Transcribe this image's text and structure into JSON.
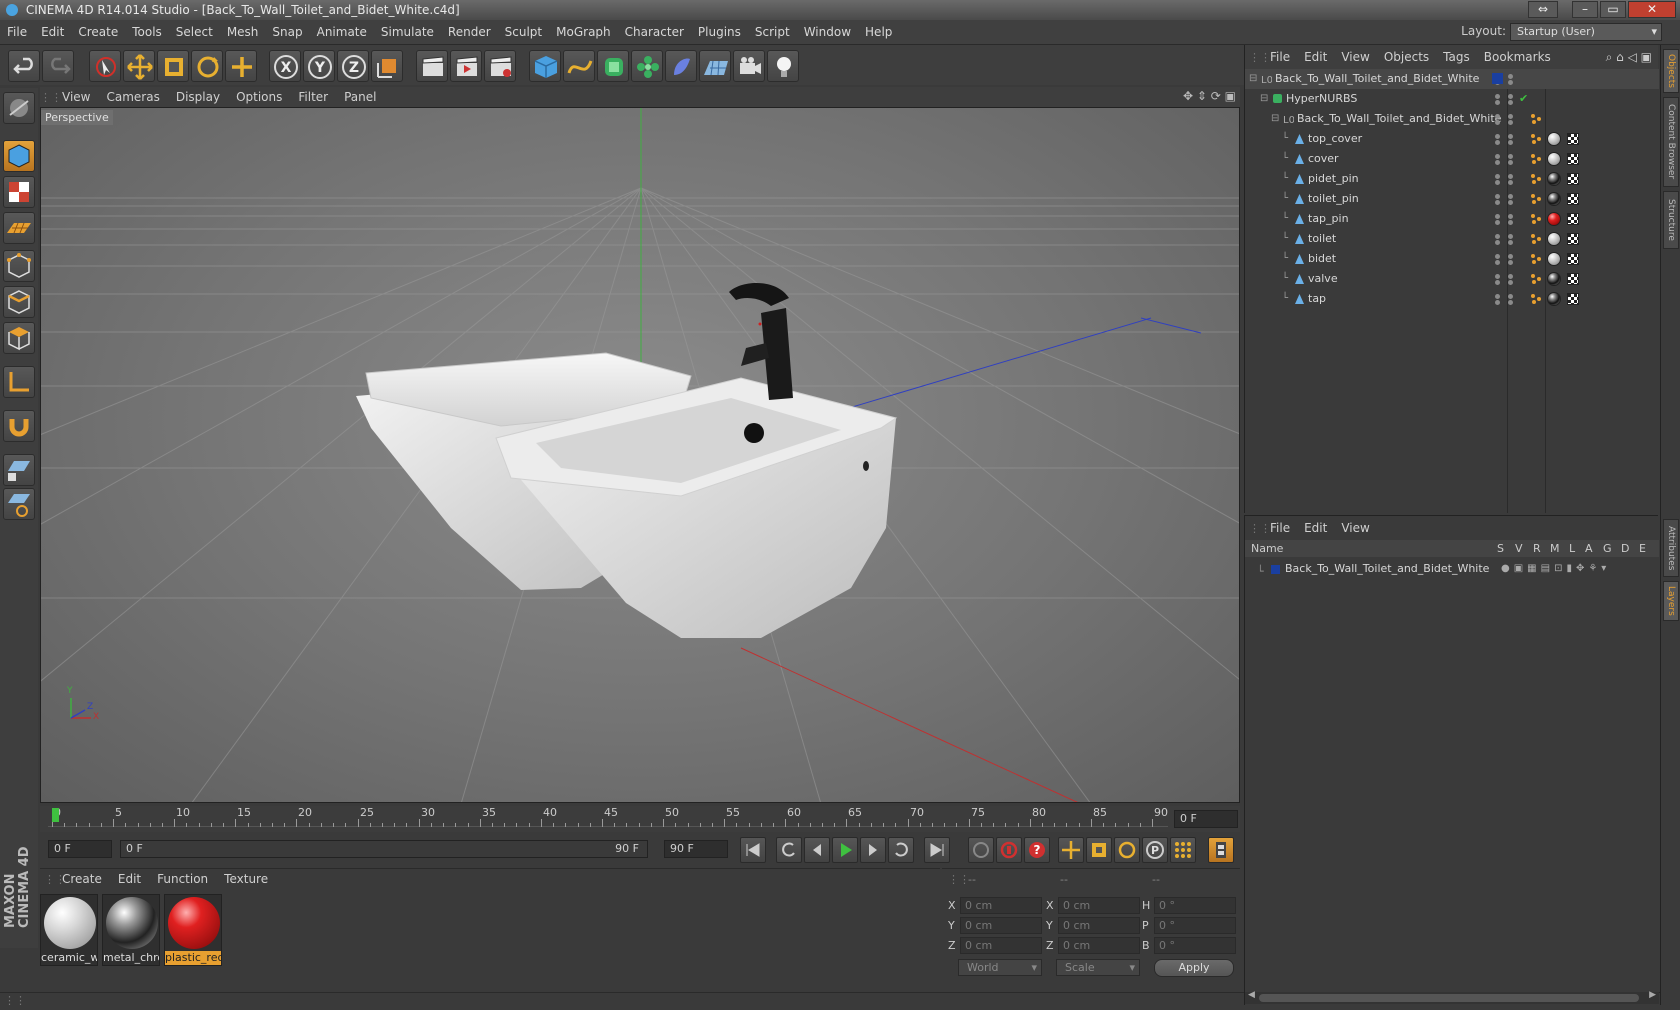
{
  "window": {
    "title": "CINEMA 4D R14.014 Studio - [Back_To_Wall_Toilet_and_Bidet_White.c4d]"
  },
  "menubar": [
    "File",
    "Edit",
    "Create",
    "Tools",
    "Select",
    "Mesh",
    "Snap",
    "Animate",
    "Simulate",
    "Render",
    "Sculpt",
    "MoGraph",
    "Character",
    "Plugins",
    "Script",
    "Window",
    "Help"
  ],
  "layout": {
    "label": "Layout:",
    "value": "Startup (User)"
  },
  "viewport": {
    "menu": [
      "View",
      "Cameras",
      "Display",
      "Options",
      "Filter",
      "Panel"
    ],
    "label": "Perspective",
    "axis": {
      "x": "X",
      "y": "Y",
      "z": "Z"
    }
  },
  "timeline": {
    "ticks": [
      "0",
      "5",
      "10",
      "15",
      "20",
      "25",
      "30",
      "35",
      "40",
      "45",
      "50",
      "55",
      "60",
      "65",
      "70",
      "75",
      "80",
      "85",
      "90"
    ],
    "current_frame": "0 F",
    "start_field": "0 F",
    "range_start": "0 F",
    "range_end": "90 F",
    "end_field": "90 F"
  },
  "materials": {
    "menu": [
      "Create",
      "Edit",
      "Function",
      "Texture"
    ],
    "items": [
      {
        "label": "ceramic_wh"
      },
      {
        "label": "metal_chro"
      },
      {
        "label": "plastic_red"
      }
    ]
  },
  "coords": {
    "headers": [
      "--",
      "--",
      "--"
    ],
    "rows": [
      {
        "a": "X",
        "av": "0 cm",
        "b": "X",
        "bv": "0 cm",
        "c": "H",
        "cv": "0 °"
      },
      {
        "a": "Y",
        "av": "0 cm",
        "b": "Y",
        "bv": "0 cm",
        "c": "P",
        "cv": "0 °"
      },
      {
        "a": "Z",
        "av": "0 cm",
        "b": "Z",
        "bv": "0 cm",
        "c": "B",
        "cv": "0 °"
      }
    ],
    "mode": "World",
    "scale": "Scale",
    "apply": "Apply"
  },
  "objects": {
    "menu": [
      "File",
      "Edit",
      "View",
      "Objects",
      "Tags",
      "Bookmarks"
    ],
    "items": [
      {
        "name": "Back_To_Wall_Toilet_and_Bidet_White",
        "indent": 0,
        "type": "null"
      },
      {
        "name": "HyperNURBS",
        "indent": 1,
        "type": "nurbs"
      },
      {
        "name": "Back_To_Wall_Toilet_and_Bidet_White",
        "indent": 2,
        "type": "null"
      },
      {
        "name": "top_cover",
        "indent": 3,
        "type": "poly",
        "mat": "ceramic"
      },
      {
        "name": "cover",
        "indent": 3,
        "type": "poly",
        "mat": "ceramic"
      },
      {
        "name": "pidet_pin",
        "indent": 3,
        "type": "poly",
        "mat": "chrome"
      },
      {
        "name": "toilet_pin",
        "indent": 3,
        "type": "poly",
        "mat": "chrome"
      },
      {
        "name": "tap_pin",
        "indent": 3,
        "type": "poly",
        "mat": "red"
      },
      {
        "name": "toilet",
        "indent": 3,
        "type": "poly",
        "mat": "ceramic"
      },
      {
        "name": "bidet",
        "indent": 3,
        "type": "poly",
        "mat": "ceramic"
      },
      {
        "name": "valve",
        "indent": 3,
        "type": "poly",
        "mat": "chrome"
      },
      {
        "name": "tap",
        "indent": 3,
        "type": "poly",
        "mat": "chrome"
      }
    ]
  },
  "layers": {
    "menu": [
      "File",
      "Edit",
      "View"
    ],
    "columns": [
      "Name",
      "S",
      "V",
      "R",
      "M",
      "L",
      "A",
      "G",
      "D",
      "E"
    ],
    "items": [
      {
        "name": "Back_To_Wall_Toilet_and_Bidet_White",
        "color": "#1a3fa0"
      }
    ]
  },
  "sidetabs": [
    "Objects",
    "Content Browser",
    "Structure",
    "Attributes",
    "Layers"
  ],
  "branding": {
    "logo": "MAXON CINEMA 4D"
  },
  "colors": {
    "accent": "#e8a030",
    "red_material": "#d01818",
    "layer_blue": "#1a3fa0"
  }
}
